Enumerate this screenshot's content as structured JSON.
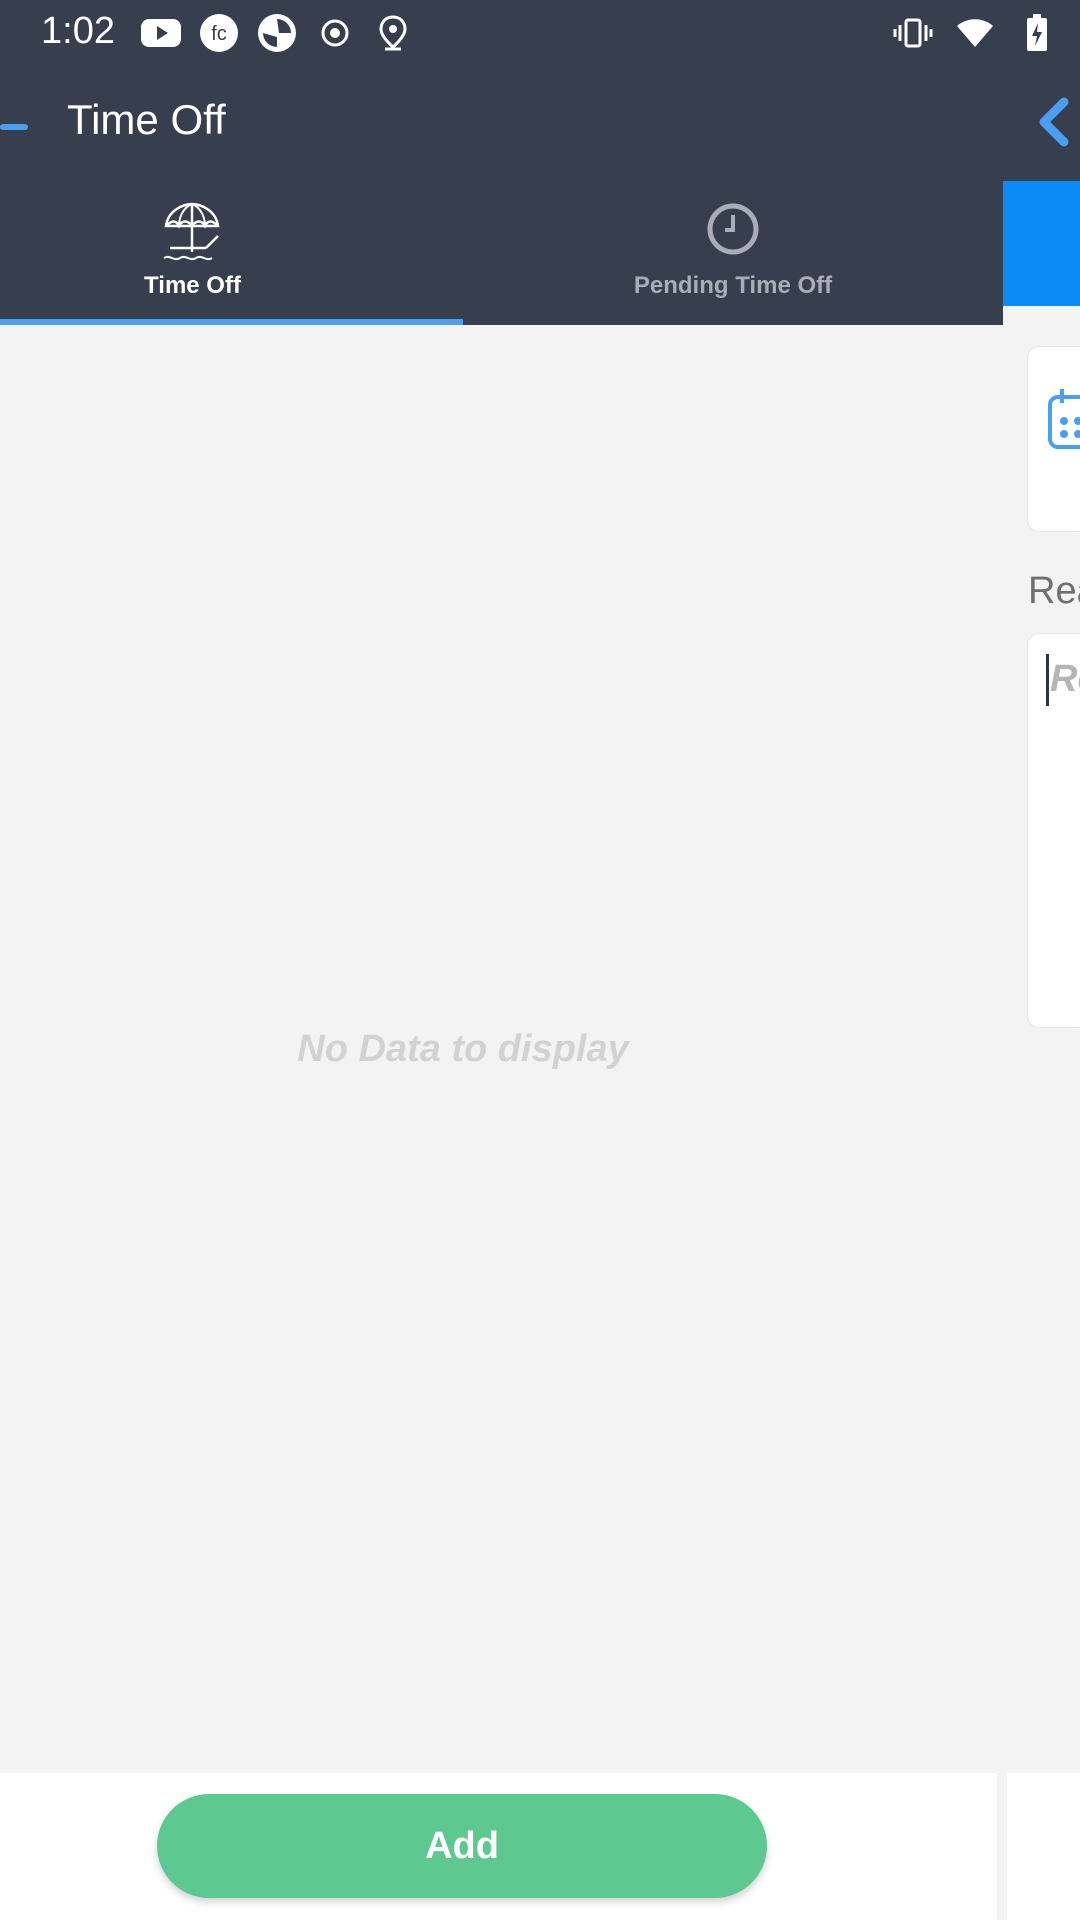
{
  "status_bar": {
    "time": "1:02",
    "left_icons": [
      "youtube-icon",
      "fc-app-icon",
      "aperture-icon",
      "record-icon",
      "location-icon"
    ],
    "right_icons": [
      "vibrate-icon",
      "wifi-icon",
      "battery-charging-icon"
    ]
  },
  "app_bar": {
    "title": "Time Off"
  },
  "tabs": [
    {
      "label": "Time Off",
      "icon": "beach-umbrella-icon",
      "selected": true
    },
    {
      "label": "Pending Time Off",
      "icon": "clock-icon",
      "selected": false
    }
  ],
  "main": {
    "empty_message": "No Data to display"
  },
  "side_panel": {
    "reason_label": "Rea",
    "reason_placeholder": "Re"
  },
  "footer": {
    "add_label": "Add"
  },
  "colors": {
    "header_bg": "#373e4d",
    "tab_indicator": "#4a9ff0",
    "accent_blue": "#0a8bf5",
    "add_button": "#5dc88f",
    "page_bg": "#f3f3f3"
  }
}
